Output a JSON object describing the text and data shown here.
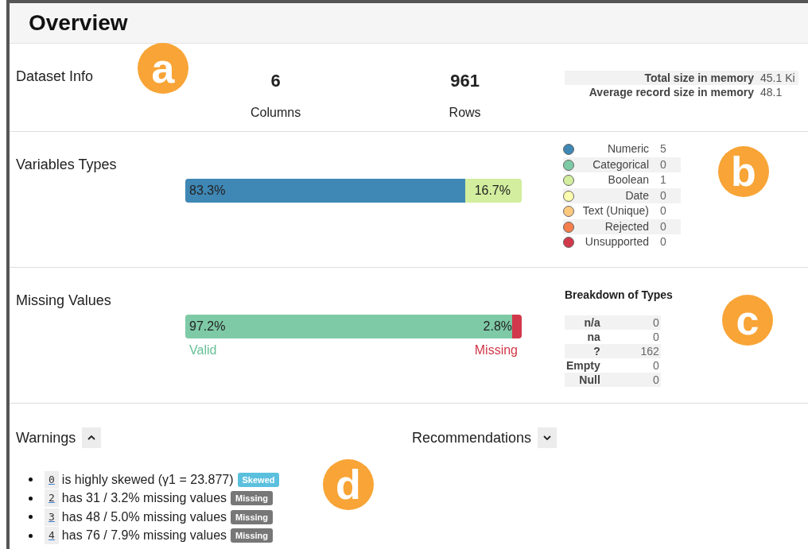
{
  "title": "Overview",
  "dataset_info": {
    "label": "Dataset Info",
    "stats": [
      {
        "value": "6",
        "label": "Columns"
      },
      {
        "value": "961",
        "label": "Rows"
      }
    ],
    "memory": [
      {
        "label": "Total size in memory",
        "value": "45.1 Ki"
      },
      {
        "label": "Average record size in memory",
        "value": "48.1"
      }
    ]
  },
  "variable_types": {
    "label": "Variables Types",
    "segments": [
      {
        "text": "83.3%",
        "level": 0.833,
        "color": "#3f87b4"
      },
      {
        "text": "16.7%",
        "level": 0.167,
        "color": "#d2ee9e"
      }
    ],
    "legend": [
      {
        "name": "Numeric",
        "count": "5",
        "color": "#3f87b4"
      },
      {
        "name": "Categorical",
        "count": "0",
        "color": "#7ecaa6"
      },
      {
        "name": "Boolean",
        "count": "1",
        "color": "#d2ee9e"
      },
      {
        "name": "Date",
        "count": "0",
        "color": "#fdfdb0"
      },
      {
        "name": "Text (Unique)",
        "count": "0",
        "color": "#fdc97e"
      },
      {
        "name": "Rejected",
        "count": "0",
        "color": "#f67e4d"
      },
      {
        "name": "Unsupported",
        "count": "0",
        "color": "#d1384a"
      }
    ]
  },
  "missing_values": {
    "label": "Missing Values",
    "segments": [
      {
        "text": "97.2%",
        "level": 0.972,
        "color": "#7ecaa6"
      },
      {
        "text": "2.8%",
        "level": 0.028,
        "color": "#d1384a"
      }
    ],
    "captions": [
      {
        "text": "Valid",
        "color": "#66c096"
      },
      {
        "text": "Missing",
        "color": "#d1384a"
      }
    ],
    "breakdown_title": "Breakdown of Types",
    "breakdown": [
      {
        "name": "n/a",
        "count": "0"
      },
      {
        "name": "na",
        "count": "0"
      },
      {
        "name": "?",
        "count": "162"
      },
      {
        "name": "Empty",
        "count": "0"
      },
      {
        "name": "Null",
        "count": "0"
      }
    ]
  },
  "panels": [
    {
      "label": "Warnings",
      "expanded": true
    },
    {
      "label": "Recommendations",
      "expanded": false
    }
  ],
  "warnings": [
    {
      "column": "0",
      "text": "is highly skewed (γ1 = 23.877)",
      "badge": "Skewed",
      "kind": "skewed"
    },
    {
      "column": "2",
      "text": "has 31 / 3.2% missing values",
      "badge": "Missing",
      "kind": "missing"
    },
    {
      "column": "3",
      "text": "has 48 / 5.0% missing values",
      "badge": "Missing",
      "kind": "missing"
    },
    {
      "column": "4",
      "text": "has 76 / 7.9% missing values",
      "badge": "Missing",
      "kind": "missing"
    }
  ],
  "markers": [
    "a",
    "b",
    "c",
    "d"
  ]
}
